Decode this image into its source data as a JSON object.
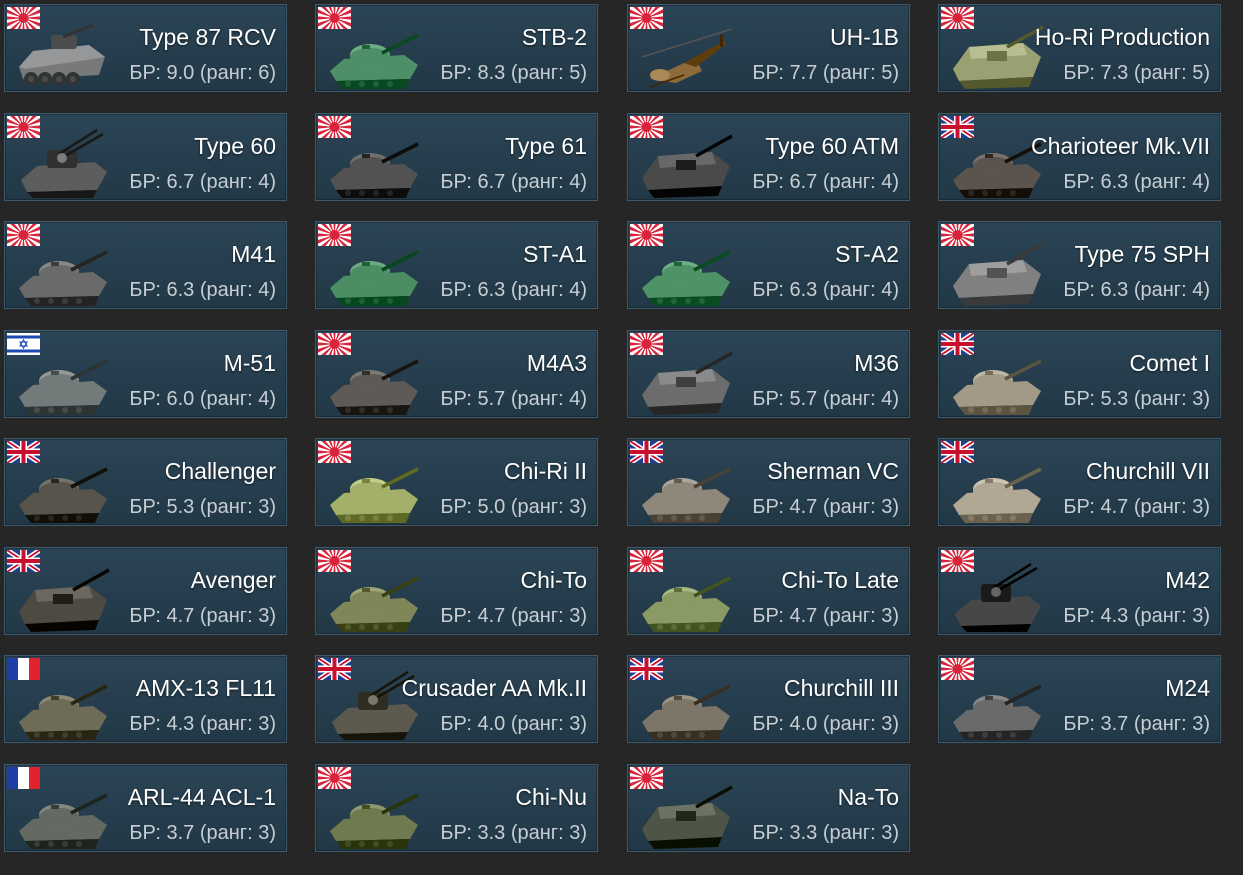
{
  "vehicles": [
    {
      "name": "Type 87 RCV",
      "br_text": "БР: 9.0 (ранг: 6)",
      "flag": "japan-flag",
      "nation": "japan",
      "vehicle_type": "wheeled",
      "color": "#77797a"
    },
    {
      "name": "STB-2",
      "br_text": "БР: 8.3 (ранг: 5)",
      "flag": "japan-flag",
      "nation": "japan",
      "vehicle_type": "tank",
      "color": "#4f8f67"
    },
    {
      "name": "UH-1B",
      "br_text": "БР: 7.7 (ранг: 5)",
      "flag": "japan-flag",
      "nation": "japan",
      "vehicle_type": "helicopter",
      "color": "#8d6a3a"
    },
    {
      "name": "Ho-Ri Production",
      "br_text": "БР: 7.3 (ранг: 5)",
      "flag": "japan-flag",
      "nation": "japan",
      "vehicle_type": "tank-destroyer",
      "color": "#9aa072"
    },
    {
      "name": "Type 60",
      "br_text": "БР: 6.7 (ранг: 4)",
      "flag": "japan-flag",
      "nation": "japan",
      "vehicle_type": "spaa",
      "color": "#5d5d5d"
    },
    {
      "name": "Type 61",
      "br_text": "БР: 6.7 (ранг: 4)",
      "flag": "japan-flag",
      "nation": "japan",
      "vehicle_type": "tank",
      "color": "#525252"
    },
    {
      "name": "Type 60 ATM",
      "br_text": "БР: 6.7 (ранг: 4)",
      "flag": "japan-flag",
      "nation": "japan",
      "vehicle_type": "atgm",
      "color": "#4a4a4a"
    },
    {
      "name": "Charioteer Mk.VII",
      "br_text": "БР: 6.3 (ранг: 4)",
      "flag": "uk-flag",
      "nation": "uk",
      "vehicle_type": "tank",
      "color": "#5a544c"
    },
    {
      "name": "M41",
      "br_text": "БР: 6.3 (ранг: 4)",
      "flag": "japan-flag",
      "nation": "japan",
      "vehicle_type": "tank",
      "color": "#6a6a6a"
    },
    {
      "name": "ST-A1",
      "br_text": "БР: 6.3 (ранг: 4)",
      "flag": "japan-flag",
      "nation": "japan",
      "vehicle_type": "tank",
      "color": "#4c8d63"
    },
    {
      "name": "ST-A2",
      "br_text": "БР: 6.3 (ранг: 4)",
      "flag": "japan-flag",
      "nation": "japan",
      "vehicle_type": "tank",
      "color": "#4f9267"
    },
    {
      "name": "Type 75 SPH",
      "br_text": "БР: 6.3 (ранг: 4)",
      "flag": "japan-flag",
      "nation": "japan",
      "vehicle_type": "spg",
      "color": "#808080"
    },
    {
      "name": "M-51",
      "br_text": "БР: 6.0 (ранг: 4)",
      "flag": "israel-flag",
      "nation": "israel",
      "vehicle_type": "tank",
      "color": "#737a7a"
    },
    {
      "name": "M4A3",
      "br_text": "БР: 5.7 (ранг: 4)",
      "flag": "japan-flag",
      "nation": "japan",
      "vehicle_type": "tank",
      "color": "#5e5a55"
    },
    {
      "name": "M36",
      "br_text": "БР: 5.7 (ранг: 4)",
      "flag": "japan-flag",
      "nation": "japan",
      "vehicle_type": "tank-destroyer",
      "color": "#6c6c6c"
    },
    {
      "name": "Comet I",
      "br_text": "БР: 5.3 (ранг: 3)",
      "flag": "uk-flag",
      "nation": "uk",
      "vehicle_type": "tank",
      "color": "#a29a86"
    },
    {
      "name": "Challenger",
      "br_text": "БР: 5.3 (ранг: 3)",
      "flag": "uk-flag",
      "nation": "uk",
      "vehicle_type": "tank",
      "color": "#57544c"
    },
    {
      "name": "Chi-Ri II",
      "br_text": "БР: 5.0 (ранг: 3)",
      "flag": "japan-flag",
      "nation": "japan",
      "vehicle_type": "tank",
      "color": "#a4b06a"
    },
    {
      "name": "Sherman VC",
      "br_text": "БР: 4.7 (ранг: 3)",
      "flag": "uk-flag",
      "nation": "uk",
      "vehicle_type": "tank",
      "color": "#8f877a"
    },
    {
      "name": "Churchill VII",
      "br_text": "БР: 4.7 (ранг: 3)",
      "flag": "uk-flag",
      "nation": "uk",
      "vehicle_type": "tank",
      "color": "#b0a894"
    },
    {
      "name": "Avenger",
      "br_text": "БР: 4.7 (ранг: 3)",
      "flag": "uk-flag",
      "nation": "uk",
      "vehicle_type": "tank-destroyer",
      "color": "#4d4a42"
    },
    {
      "name": "Chi-To",
      "br_text": "БР: 4.7 (ранг: 3)",
      "flag": "japan-flag",
      "nation": "japan",
      "vehicle_type": "tank",
      "color": "#7f8758"
    },
    {
      "name": "Chi-To Late",
      "br_text": "БР: 4.7 (ранг: 3)",
      "flag": "japan-flag",
      "nation": "japan",
      "vehicle_type": "tank",
      "color": "#8a9a64"
    },
    {
      "name": "M42",
      "br_text": "БР: 4.3 (ранг: 3)",
      "flag": "japan-flag",
      "nation": "japan",
      "vehicle_type": "spaa",
      "color": "#474747"
    },
    {
      "name": "AMX-13 FL11",
      "br_text": "БР: 4.3 (ранг: 3)",
      "flag": "france-flag",
      "nation": "france",
      "vehicle_type": "tank",
      "color": "#6e6c58"
    },
    {
      "name": "Crusader AA Mk.II",
      "br_text": "БР: 4.0 (ранг: 3)",
      "flag": "uk-flag",
      "nation": "uk",
      "vehicle_type": "spaa",
      "color": "#5c5a4f"
    },
    {
      "name": "Churchill III",
      "br_text": "БР: 4.0 (ранг: 3)",
      "flag": "uk-flag",
      "nation": "uk",
      "vehicle_type": "tank",
      "color": "#7d7668"
    },
    {
      "name": "M24",
      "br_text": "БР: 3.7 (ранг: 3)",
      "flag": "japan-flag",
      "nation": "japan",
      "vehicle_type": "tank",
      "color": "#6a6a6a"
    },
    {
      "name": "ARL-44 ACL-1",
      "br_text": "БР: 3.7 (ранг: 3)",
      "flag": "france-flag",
      "nation": "france",
      "vehicle_type": "tank",
      "color": "#646a62"
    },
    {
      "name": "Chi-Nu",
      "br_text": "БР: 3.3 (ранг: 3)",
      "flag": "japan-flag",
      "nation": "japan",
      "vehicle_type": "tank",
      "color": "#6f7a50"
    },
    {
      "name": "Na-To",
      "br_text": "БР: 3.3 (ранг: 3)",
      "flag": "japan-flag",
      "nation": "japan",
      "vehicle_type": "tank-destroyer",
      "color": "#4e5546"
    }
  ],
  "colors": {
    "page_background": "#262626",
    "card_background": "#273f4f",
    "card_border": "#3d5a6d",
    "name_text": "#ffffff",
    "br_text": "#c6ced3"
  }
}
